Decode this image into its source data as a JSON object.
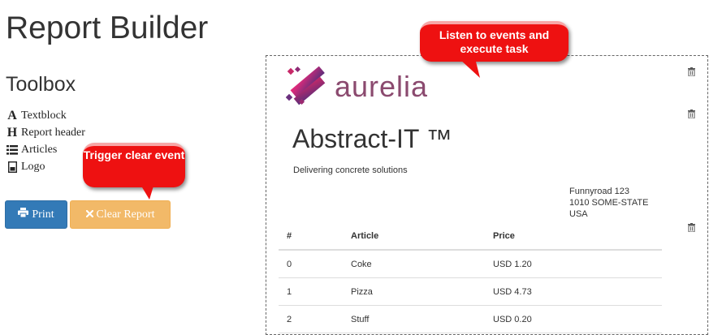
{
  "header": {
    "title": "Report Builder"
  },
  "toolbox": {
    "title": "Toolbox",
    "items": [
      {
        "label": "Textblock",
        "icon": "font-icon"
      },
      {
        "label": "Report header",
        "icon": "header-icon"
      },
      {
        "label": "Articles",
        "icon": "list-icon"
      },
      {
        "label": "Logo",
        "icon": "picture-icon"
      }
    ]
  },
  "actions": {
    "print_label": "Print",
    "clear_label": "Clear Report"
  },
  "annotations": {
    "clear": "Trigger clear event",
    "listen": "Listen to events and execute task"
  },
  "report": {
    "logo_text": "aurelia",
    "company": "Abstract-IT ™",
    "tagline": "Delivering concrete solutions",
    "address": [
      "Funnyroad 123",
      "1010 SOME-STATE",
      "USA"
    ],
    "table": {
      "headers": [
        "#",
        "Article",
        "Price"
      ],
      "rows": [
        [
          "0",
          "Coke",
          "USD 1.20"
        ],
        [
          "1",
          "Pizza",
          "USD 4.73"
        ],
        [
          "2",
          "Stuff",
          "USD 0.20"
        ]
      ]
    }
  },
  "colors": {
    "print_button": "#337ab7",
    "clear_button": "#f0ad4e",
    "callout": "#ee1111",
    "logo_text": "#8b4a6f"
  }
}
